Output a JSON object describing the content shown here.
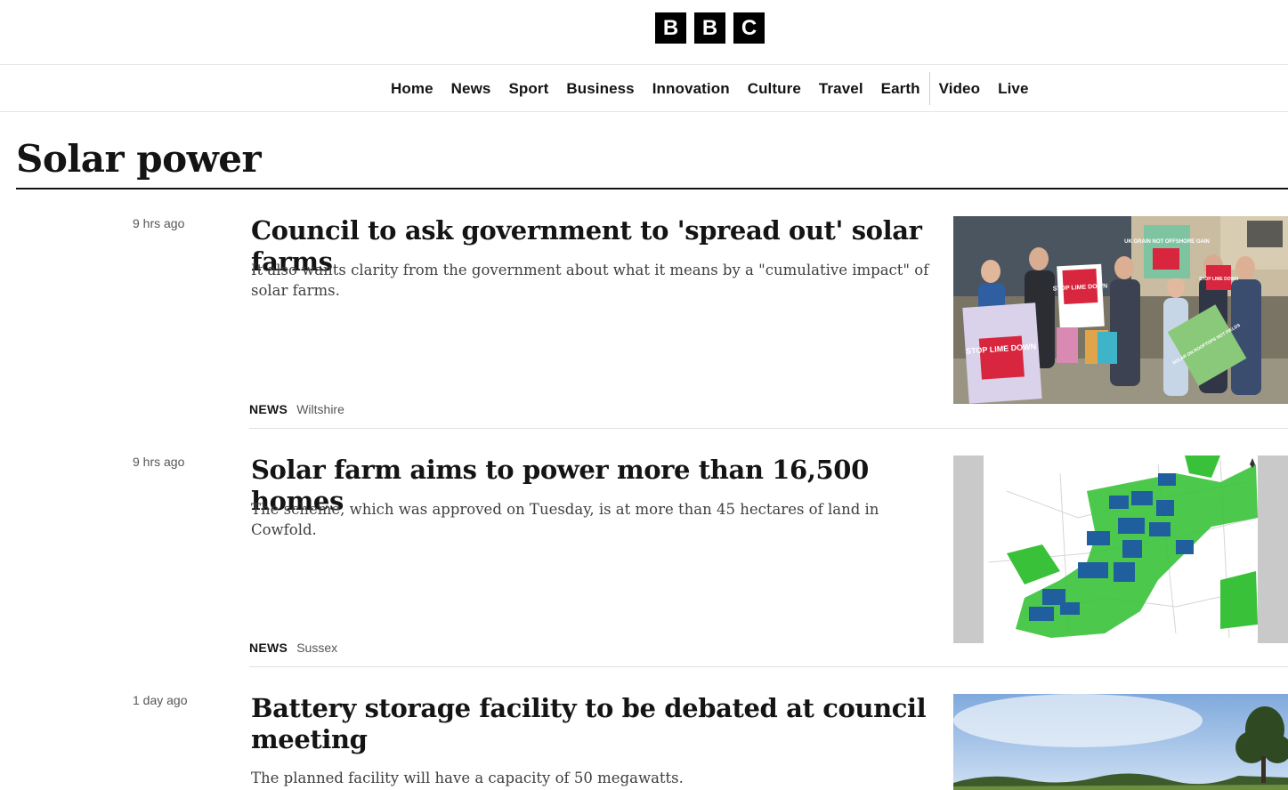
{
  "brand": {
    "logo_letters": [
      "B",
      "B",
      "C"
    ]
  },
  "nav": {
    "items": [
      "Home",
      "News",
      "Sport",
      "Business",
      "Innovation",
      "Culture",
      "Travel",
      "Earth",
      "Video",
      "Live"
    ]
  },
  "page": {
    "title": "Solar power"
  },
  "articles": [
    {
      "timestamp": "9 hrs ago",
      "headline": "Council to ask government to 'spread out' solar farms",
      "summary": "It also wants clarity from the government about what it means by a \"cumulative impact\" of solar farms.",
      "section": "NEWS",
      "region": "Wiltshire",
      "image_signs": {
        "sign1": "STOP LIME DOWN",
        "sign2": "STOP LIME DOWN",
        "sign3": "UK GRAIN NOT OFFSHORE GAIN",
        "sign4": "STOP LIME DOWN",
        "sign5": "SOLAR ON ROOFTOPS NOT FIELDS"
      }
    },
    {
      "timestamp": "9 hrs ago",
      "headline": "Solar farm aims to power more than 16,500 homes",
      "summary": "The scheme, which was approved on Tuesday, is at more than 45 hectares of land in Cowfold.",
      "section": "NEWS",
      "region": "Sussex"
    },
    {
      "timestamp": "1 day ago",
      "headline": "Battery storage facility to be debated at council meeting",
      "summary": "The planned facility will have a capacity of 50 megawatts."
    }
  ],
  "colors": {
    "sign_red": "#d7263d",
    "map_green": "#39c239",
    "map_blue": "#1f5f9e",
    "sky_blue": "#a9c9ef"
  }
}
